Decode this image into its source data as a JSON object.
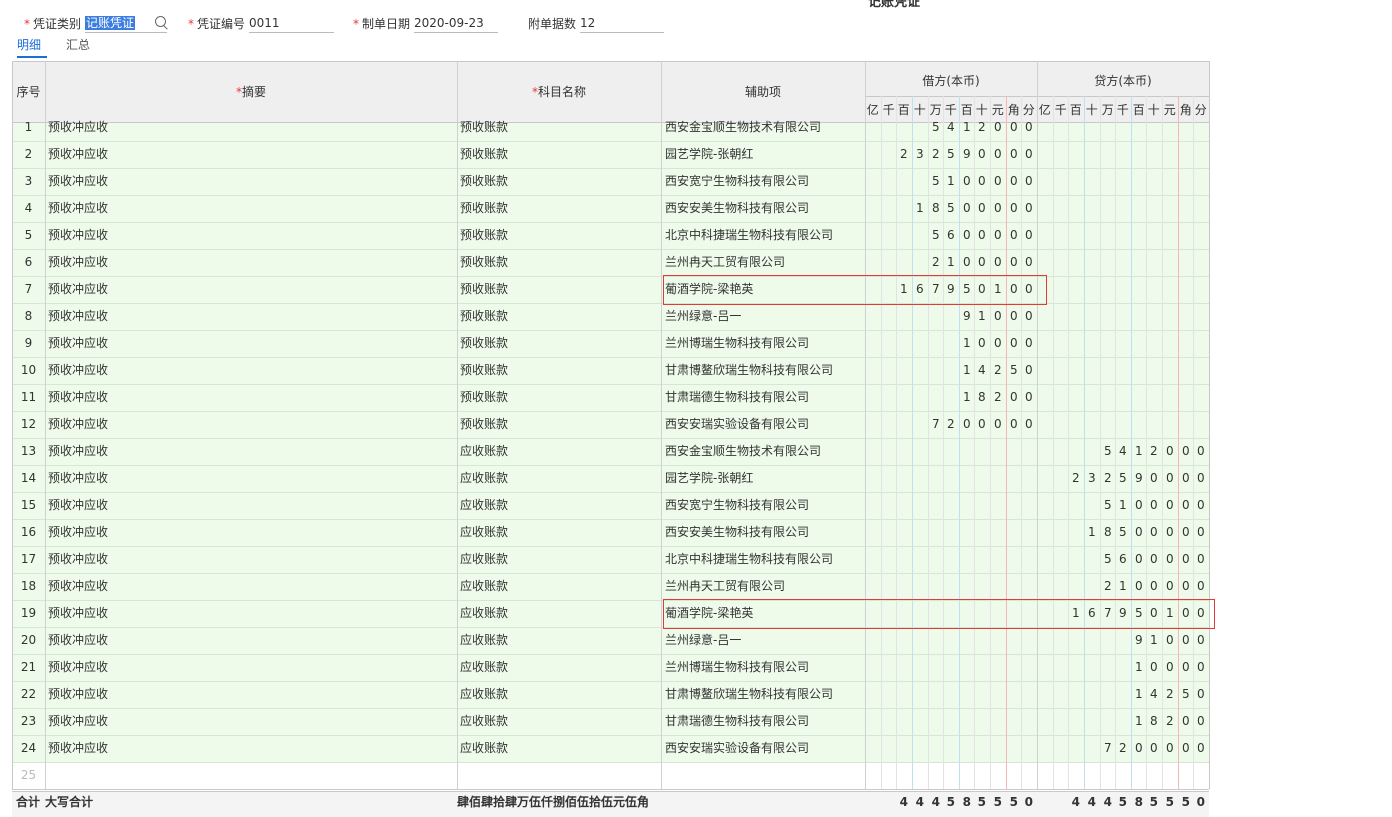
{
  "page": {
    "title_clipped": "记账凭证"
  },
  "header": {
    "voucher_type_label": "凭证类别",
    "voucher_type_value": "记账凭证",
    "voucher_no_label": "凭证编号",
    "voucher_no_value": "0011",
    "date_label": "制单日期",
    "date_value": "2020-09-23",
    "attachments_label": "附单据数",
    "attachments_value": "12"
  },
  "tabs": [
    {
      "label": "明细",
      "active": true
    },
    {
      "label": "汇总",
      "active": false
    }
  ],
  "table": {
    "headers": {
      "seq": "序号",
      "summary": "摘要",
      "account": "科目名称",
      "aux": "辅助项",
      "debit": "借方(本币)",
      "credit": "贷方(本币)"
    },
    "digit_units": [
      "亿",
      "千",
      "百",
      "十",
      "万",
      "千",
      "百",
      "十",
      "元",
      "角",
      "分"
    ],
    "rows": [
      {
        "seq": "1",
        "summary": "预收冲应收",
        "account": "预收账款",
        "aux": "西安金宝顺生物技术有限公司",
        "debit": "5412000",
        "credit": ""
      },
      {
        "seq": "2",
        "summary": "预收冲应收",
        "account": "预收账款",
        "aux": "园艺学院-张朝红",
        "debit": "232590000",
        "credit": ""
      },
      {
        "seq": "3",
        "summary": "预收冲应收",
        "account": "预收账款",
        "aux": "西安宽宁生物科技有限公司",
        "debit": "5100000",
        "credit": ""
      },
      {
        "seq": "4",
        "summary": "预收冲应收",
        "account": "预收账款",
        "aux": "西安安美生物科技有限公司",
        "debit": "18500000",
        "credit": ""
      },
      {
        "seq": "5",
        "summary": "预收冲应收",
        "account": "预收账款",
        "aux": "北京中科捷瑞生物科技有限公司",
        "debit": "5600000",
        "credit": ""
      },
      {
        "seq": "6",
        "summary": "预收冲应收",
        "account": "预收账款",
        "aux": "兰州冉天工贸有限公司",
        "debit": "2100000",
        "credit": ""
      },
      {
        "seq": "7",
        "summary": "预收冲应收",
        "account": "预收账款",
        "aux": "葡酒学院-梁艳英",
        "debit": "167950100",
        "credit": ""
      },
      {
        "seq": "8",
        "summary": "预收冲应收",
        "account": "预收账款",
        "aux": "兰州绿意-吕一",
        "debit": "91000",
        "credit": ""
      },
      {
        "seq": "9",
        "summary": "预收冲应收",
        "account": "预收账款",
        "aux": "兰州博瑞生物科技有限公司",
        "debit": "10000",
        "credit": ""
      },
      {
        "seq": "10",
        "summary": "预收冲应收",
        "account": "预收账款",
        "aux": "甘肃博鳌欣瑞生物科技有限公司",
        "debit": "14250",
        "credit": ""
      },
      {
        "seq": "11",
        "summary": "预收冲应收",
        "account": "预收账款",
        "aux": "甘肃瑞德生物科技有限公司",
        "debit": "18200",
        "credit": ""
      },
      {
        "seq": "12",
        "summary": "预收冲应收",
        "account": "预收账款",
        "aux": "西安安瑞实验设备有限公司",
        "debit": "7200000",
        "credit": ""
      },
      {
        "seq": "13",
        "summary": "预收冲应收",
        "account": "应收账款",
        "aux": "西安金宝顺生物技术有限公司",
        "debit": "",
        "credit": "5412000"
      },
      {
        "seq": "14",
        "summary": "预收冲应收",
        "account": "应收账款",
        "aux": "园艺学院-张朝红",
        "debit": "",
        "credit": "232590000"
      },
      {
        "seq": "15",
        "summary": "预收冲应收",
        "account": "应收账款",
        "aux": "西安宽宁生物科技有限公司",
        "debit": "",
        "credit": "5100000"
      },
      {
        "seq": "16",
        "summary": "预收冲应收",
        "account": "应收账款",
        "aux": "西安安美生物科技有限公司",
        "debit": "",
        "credit": "18500000"
      },
      {
        "seq": "17",
        "summary": "预收冲应收",
        "account": "应收账款",
        "aux": "北京中科捷瑞生物科技有限公司",
        "debit": "",
        "credit": "5600000"
      },
      {
        "seq": "18",
        "summary": "预收冲应收",
        "account": "应收账款",
        "aux": "兰州冉天工贸有限公司",
        "debit": "",
        "credit": "2100000"
      },
      {
        "seq": "19",
        "summary": "预收冲应收",
        "account": "应收账款",
        "aux": "葡酒学院-梁艳英",
        "debit": "",
        "credit": "167950100"
      },
      {
        "seq": "20",
        "summary": "预收冲应收",
        "account": "应收账款",
        "aux": "兰州绿意-吕一",
        "debit": "",
        "credit": "91000"
      },
      {
        "seq": "21",
        "summary": "预收冲应收",
        "account": "应收账款",
        "aux": "兰州博瑞生物科技有限公司",
        "debit": "",
        "credit": "10000"
      },
      {
        "seq": "22",
        "summary": "预收冲应收",
        "account": "应收账款",
        "aux": "甘肃博鳌欣瑞生物科技有限公司",
        "debit": "",
        "credit": "14250"
      },
      {
        "seq": "23",
        "summary": "预收冲应收",
        "account": "应收账款",
        "aux": "甘肃瑞德生物科技有限公司",
        "debit": "",
        "credit": "18200"
      },
      {
        "seq": "24",
        "summary": "预收冲应收",
        "account": "应收账款",
        "aux": "西安安瑞实验设备有限公司",
        "debit": "",
        "credit": "7200000"
      }
    ],
    "empty_row_seq": "25",
    "highlighted_rows": [
      "7",
      "19"
    ],
    "totals": {
      "label": "合计",
      "caps_label": "大写合计",
      "caps_amount": "肆佰肆拾肆万伍仟捌佰伍拾伍元伍角",
      "debit": "444585550",
      "credit": "444585550"
    }
  },
  "colors": {
    "row_bg": "#eefbea",
    "header_bg": "#efefef",
    "accent": "#1b6fd6",
    "required": "#e53935",
    "highlight_border": "#e53935"
  }
}
